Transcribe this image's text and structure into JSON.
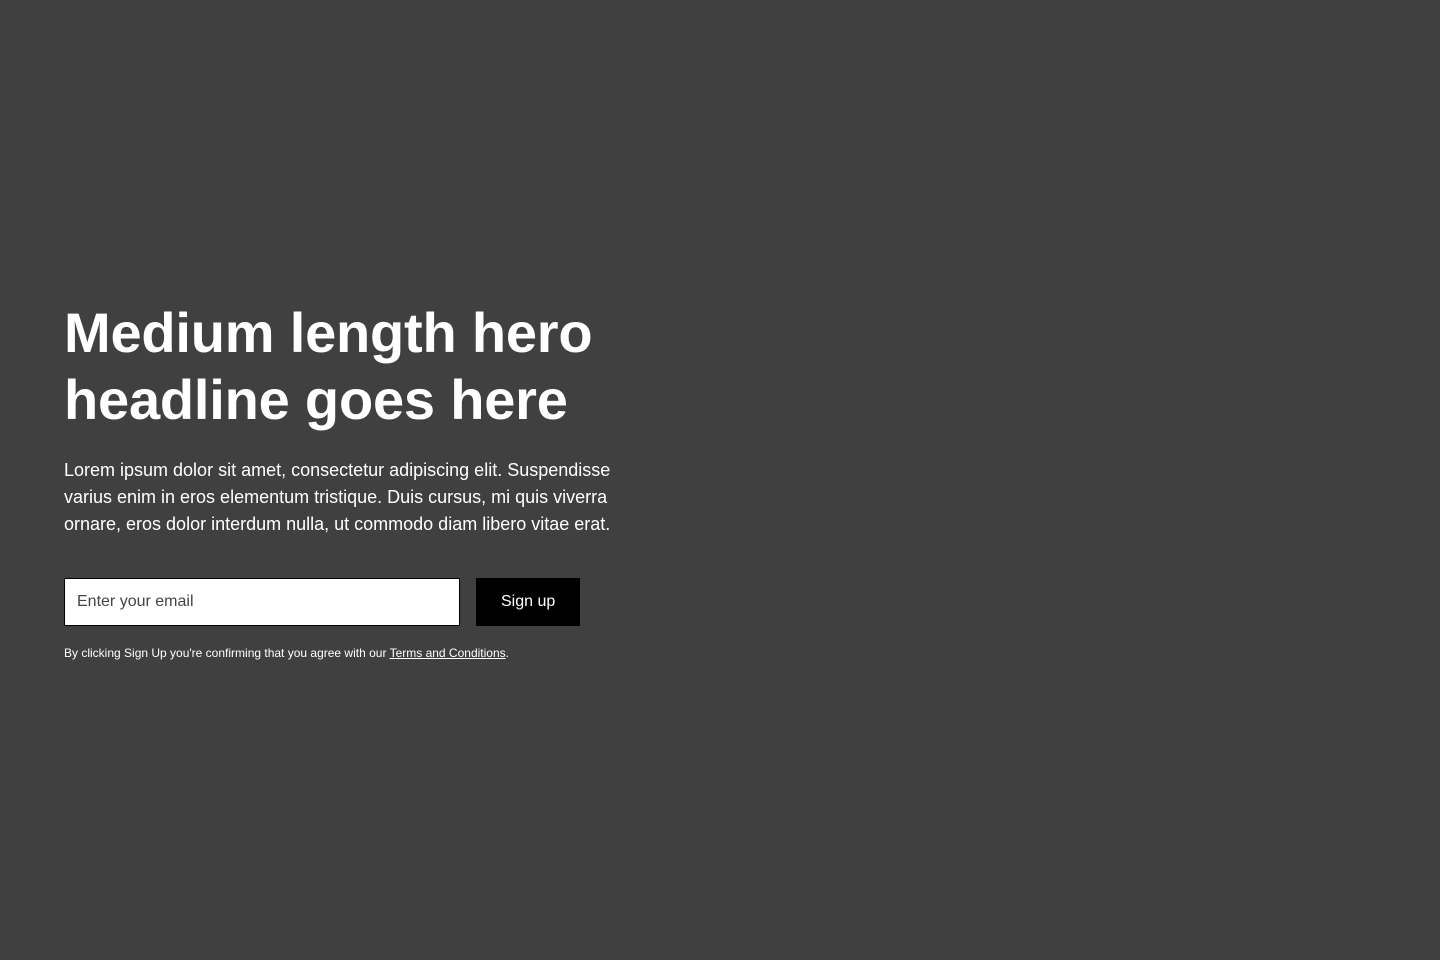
{
  "colors": {
    "background": "#404040",
    "text": "#ffffff",
    "button_bg": "#000000",
    "input_bg": "#ffffff"
  },
  "hero": {
    "headline_line1": "Medium length hero",
    "headline_line2": "headline goes here",
    "body": "Lorem ipsum dolor sit amet, consectetur adipiscing elit. Suspendisse varius enim in eros elementum tristique. Duis cursus, mi quis viverra ornare, eros dolor interdum nulla, ut commodo diam libero vitae erat.",
    "email_placeholder": "Enter your email",
    "email_value": "",
    "signup_label": "Sign up",
    "disclaimer_prefix": "By clicking Sign Up you're confirming that you agree with our ",
    "terms_label": "Terms and Conditions",
    "disclaimer_suffix": "."
  }
}
